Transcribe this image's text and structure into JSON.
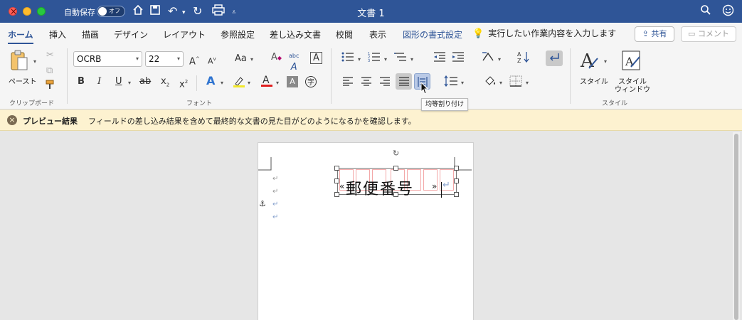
{
  "window": {
    "autosave_label": "自動保存",
    "autosave_state": "オフ",
    "title": "文書 1"
  },
  "tabs": [
    {
      "label": "ホーム"
    },
    {
      "label": "挿入"
    },
    {
      "label": "描画"
    },
    {
      "label": "デザイン"
    },
    {
      "label": "レイアウト"
    },
    {
      "label": "参照設定"
    },
    {
      "label": "差し込み文書"
    },
    {
      "label": "校閲"
    },
    {
      "label": "表示"
    },
    {
      "label": "図形の書式設定"
    }
  ],
  "tellme": "実行したい作業内容を入力します",
  "share_label": "共有",
  "comment_label": "コメント",
  "ribbon": {
    "paste_label": "ペースト",
    "clipboard_group": "クリップボード",
    "font_name": "OCRB",
    "font_size": "22",
    "font_group": "フォント",
    "style_label": "スタイル",
    "style_window_label_1": "スタイル",
    "style_window_label_2": "ウィンドウ",
    "style_group": "スタイル",
    "btn_bold": "B",
    "btn_italic": "I",
    "btn_underline": "U",
    "btn_strike": "ab",
    "btn_sub": "x",
    "btn_sup": "x",
    "btn_grow": "A",
    "btn_shrink": "A",
    "btn_case": "Aa",
    "ruby": "abc"
  },
  "tooltip": "均等割り付け",
  "message": {
    "title": "プレビュー結果",
    "text": "フィールドの差し込み結果を含めて最終的な文書の見た目がどのようになるかを確認します。"
  },
  "document": {
    "postal_text": "郵便番号"
  },
  "colors": {
    "title_bar": "#2f5597",
    "accent": "#2f5597",
    "message_bar": "#fdf2d0"
  }
}
